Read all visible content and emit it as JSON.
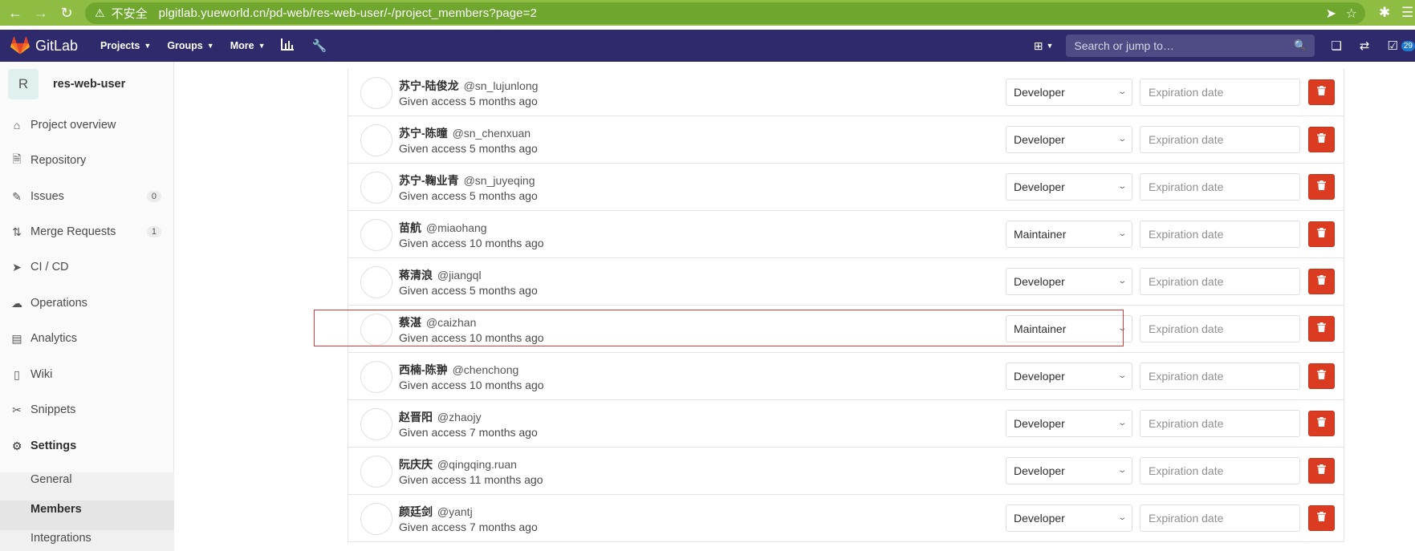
{
  "browser": {
    "insecure_label": "不安全",
    "url": "plgitlab.yueworld.cn/pd-web/res-web-user/-/project_members?page=2"
  },
  "header": {
    "brand": "GitLab",
    "menu": [
      {
        "label": "Projects"
      },
      {
        "label": "Groups"
      },
      {
        "label": "More"
      }
    ],
    "search_placeholder": "Search or jump to…",
    "todo_count": "29"
  },
  "sidebar": {
    "project_initial": "R",
    "project_name": "res-web-user",
    "items": [
      {
        "label": "Project overview",
        "icon": "home-icon"
      },
      {
        "label": "Repository",
        "icon": "doc-icon"
      },
      {
        "label": "Issues",
        "icon": "issues-icon",
        "count": "0"
      },
      {
        "label": "Merge Requests",
        "icon": "merge-icon",
        "count": "1"
      },
      {
        "label": "CI / CD",
        "icon": "rocket-icon"
      },
      {
        "label": "Operations",
        "icon": "cloud-icon"
      },
      {
        "label": "Analytics",
        "icon": "chart-icon"
      },
      {
        "label": "Wiki",
        "icon": "book-icon"
      },
      {
        "label": "Snippets",
        "icon": "scissors-icon"
      },
      {
        "label": "Settings",
        "icon": "gear-icon"
      }
    ],
    "settings_sub": [
      {
        "label": "General"
      },
      {
        "label": "Members"
      },
      {
        "label": "Integrations"
      }
    ]
  },
  "members": {
    "expiration_placeholder": "Expiration date",
    "rows": [
      {
        "name": "苏宁-陆俊龙",
        "handle": "@sn_lujunlong",
        "given": "Given access 5 months ago",
        "role": "Developer"
      },
      {
        "name": "苏宁-陈曈",
        "handle": "@sn_chenxuan",
        "given": "Given access 5 months ago",
        "role": "Developer"
      },
      {
        "name": "苏宁-鞠业青",
        "handle": "@sn_juyeqing",
        "given": "Given access 5 months ago",
        "role": "Developer"
      },
      {
        "name": "苗航",
        "handle": "@miaohang",
        "given": "Given access 10 months ago",
        "role": "Maintainer"
      },
      {
        "name": "蒋清浪",
        "handle": "@jiangql",
        "given": "Given access 5 months ago",
        "role": "Developer"
      },
      {
        "name": "蔡湛",
        "handle": "@caizhan",
        "given": "Given access 10 months ago",
        "role": "Maintainer"
      },
      {
        "name": "西楠-陈翀",
        "handle": "@chenchong",
        "given": "Given access 10 months ago",
        "role": "Developer"
      },
      {
        "name": "赵晋阳",
        "handle": "@zhaojy",
        "given": "Given access 7 months ago",
        "role": "Developer"
      },
      {
        "name": "阮庆庆",
        "handle": "@qingqing.ruan",
        "given": "Given access 11 months ago",
        "role": "Developer"
      },
      {
        "name": "颜廷剑",
        "handle": "@yantj",
        "given": "Given access 7 months ago",
        "role": "Developer"
      }
    ]
  },
  "colors": {
    "browser_bar": "#8fbc43",
    "gitlab_header": "#2f2a6b",
    "danger": "#db3b21",
    "highlight": "#e03a3a"
  }
}
